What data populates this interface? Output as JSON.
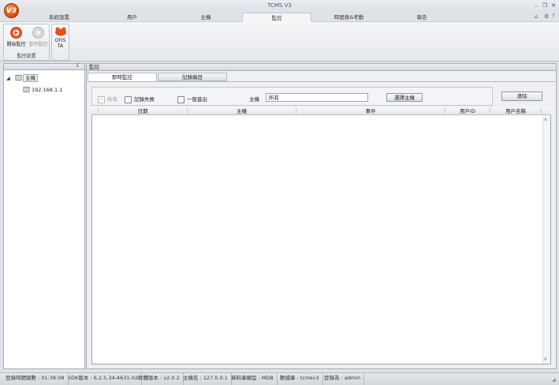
{
  "window": {
    "title": "TCMS V3",
    "logo_text": "V3",
    "help": "?"
  },
  "tabs": [
    "系統設置",
    "用戶",
    "主機",
    "監控",
    "時間表&考勤",
    "報告"
  ],
  "active_tab": "監控",
  "ribbon": {
    "start_label": "開始監控",
    "pause_label": "暫停監控",
    "group_label": "監控設置",
    "ofis_label1": "OFIS",
    "ofis_label2": "TA"
  },
  "tree": {
    "root": "主機",
    "child": "192.168.1.1"
  },
  "panel_title": "監控",
  "subtabs": [
    "即時監控",
    "記錄編目"
  ],
  "filters": {
    "all_label": "所有",
    "fail_label": "記錄失敗",
    "general_label": "一般進出",
    "host_label": "主機",
    "host_value": "所有",
    "select_host_button": "選擇主機",
    "clear_button": "清除"
  },
  "grid": {
    "columns": [
      "日期",
      "主機",
      "事件",
      "用戶ID",
      "用戶名稱"
    ]
  },
  "status": [
    "登錄時間總數 : 01:39:08",
    "SDK版本 : 6.2.5.34-4631-02",
    "軟體版本 : v2.0.2",
    "主機名 : 127.0.0.1",
    "資料庫類型 : MDB",
    "數據庫 : tcmsv3",
    "登錄為 : admin"
  ]
}
